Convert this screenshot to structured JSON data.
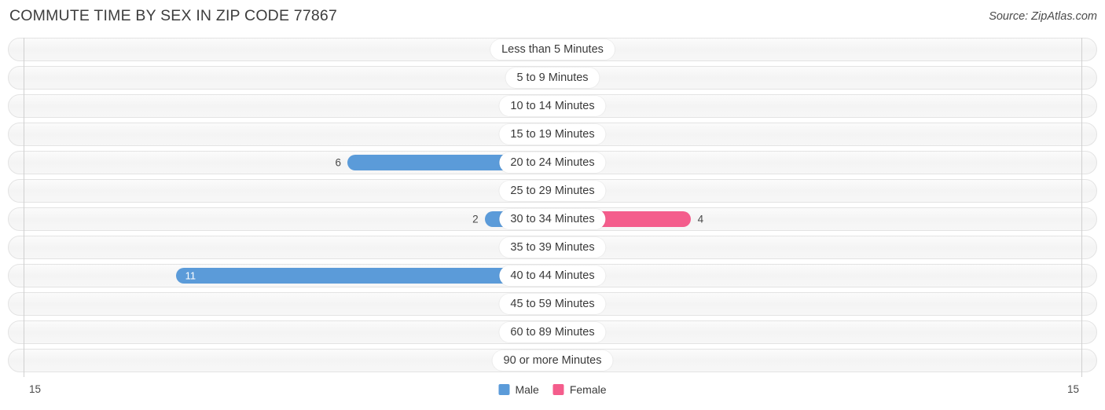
{
  "header": {
    "title": "COMMUTE TIME BY SEX IN ZIP CODE 77867",
    "source": "Source: ZipAtlas.com"
  },
  "colors": {
    "male_strong": "#5b9bd9",
    "male_light": "#a8c8ec",
    "female_strong": "#f45d8c",
    "female_light": "#f7a8c4",
    "row_bg": "#f7f7f7",
    "row_border": "#e3e3e3",
    "axis_line": "#d0d0d0"
  },
  "axis": {
    "left_label": "15",
    "right_label": "15",
    "max": 15
  },
  "legend": [
    {
      "label": "Male",
      "color": "#5b9bd9",
      "swatch": "male-swatch"
    },
    {
      "label": "Female",
      "color": "#f45d8c",
      "swatch": "female-swatch"
    }
  ],
  "chart_data": {
    "type": "bar",
    "orientation": "horizontal",
    "layout": "diverging-centered",
    "title": "COMMUTE TIME BY SEX IN ZIP CODE 77867",
    "xlabel": "",
    "ylabel": "",
    "xlim": [
      0,
      15
    ],
    "grid": false,
    "legend_position": "bottom-center",
    "categories": [
      "Less than 5 Minutes",
      "5 to 9 Minutes",
      "10 to 14 Minutes",
      "15 to 19 Minutes",
      "20 to 24 Minutes",
      "25 to 29 Minutes",
      "30 to 34 Minutes",
      "35 to 39 Minutes",
      "40 to 44 Minutes",
      "45 to 59 Minutes",
      "60 to 89 Minutes",
      "90 or more Minutes"
    ],
    "series": [
      {
        "name": "Male",
        "side": "left",
        "values": [
          0,
          0,
          0,
          0,
          6,
          0,
          2,
          0,
          11,
          0,
          0,
          0
        ]
      },
      {
        "name": "Female",
        "side": "right",
        "values": [
          0,
          0,
          0,
          0,
          0,
          0,
          4,
          0,
          0,
          0,
          0,
          0
        ]
      }
    ]
  },
  "rows": [
    {
      "label": "Less than 5 Minutes",
      "male": "0",
      "female": "0"
    },
    {
      "label": "5 to 9 Minutes",
      "male": "0",
      "female": "0"
    },
    {
      "label": "10 to 14 Minutes",
      "male": "0",
      "female": "0"
    },
    {
      "label": "15 to 19 Minutes",
      "male": "0",
      "female": "0"
    },
    {
      "label": "20 to 24 Minutes",
      "male": "6",
      "female": "0"
    },
    {
      "label": "25 to 29 Minutes",
      "male": "0",
      "female": "0"
    },
    {
      "label": "30 to 34 Minutes",
      "male": "2",
      "female": "4"
    },
    {
      "label": "35 to 39 Minutes",
      "male": "0",
      "female": "0"
    },
    {
      "label": "40 to 44 Minutes",
      "male": "11",
      "female": "0"
    },
    {
      "label": "45 to 59 Minutes",
      "male": "0",
      "female": "0"
    },
    {
      "label": "60 to 89 Minutes",
      "male": "0",
      "female": "0"
    },
    {
      "label": "90 or more Minutes",
      "male": "0",
      "female": "0"
    }
  ]
}
